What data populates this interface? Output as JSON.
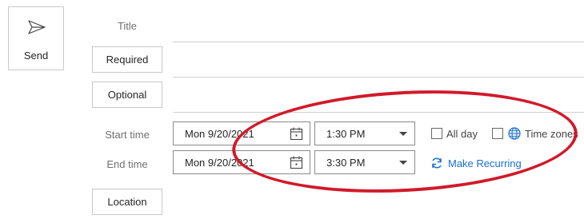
{
  "send": {
    "label": "Send",
    "icon": "send-icon"
  },
  "fields": {
    "title_label": "Title",
    "required_label": "Required",
    "optional_label": "Optional",
    "start_label": "Start time",
    "end_label": "End time",
    "location_label": "Location"
  },
  "start": {
    "date": "Mon 9/20/2021",
    "time": "1:30 PM"
  },
  "end": {
    "date": "Mon 9/20/2021",
    "time": "3:30 PM"
  },
  "options": {
    "all_day": "All day",
    "time_zones": "Time zones",
    "make_recurring": "Make Recurring"
  },
  "colors": {
    "annotation": "#d11a2a",
    "link": "#1a6fd1"
  }
}
